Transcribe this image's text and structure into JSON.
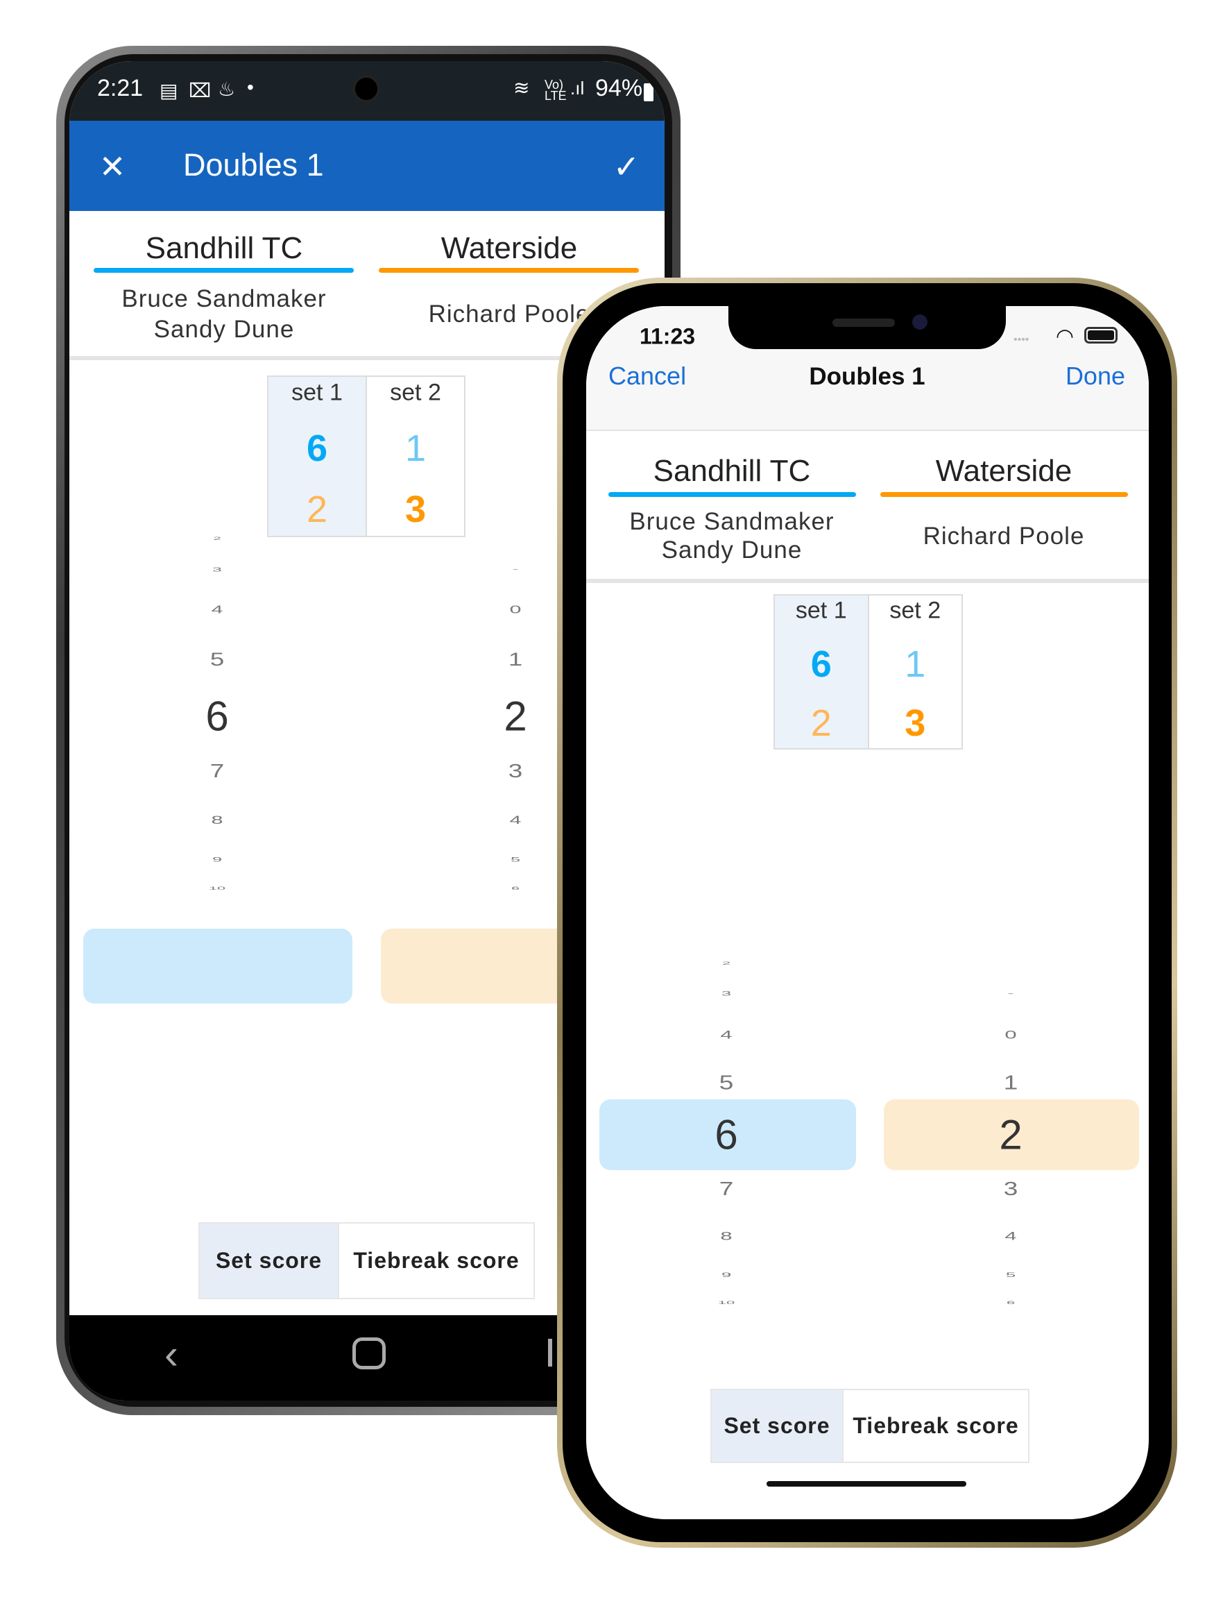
{
  "colors": {
    "home": "#03a9f4",
    "away": "#ff9800",
    "android_appbar": "#1565c0",
    "ios_link": "#1a6fd6",
    "home_highlight": "#cdeafc",
    "away_highlight": "#fdebd0",
    "set_selected_bg": "#ecf2fa"
  },
  "android": {
    "status": {
      "time": "2:21",
      "battery": "94%",
      "icons": [
        "calendar-icon",
        "outlook-icon",
        "notification-icon",
        "dot-icon",
        "wifi-icon",
        "volte-icon",
        "signal-icon",
        "battery-icon"
      ]
    },
    "appbar": {
      "title": "Doubles 1",
      "close_icon": "close-icon",
      "confirm_icon": "check-icon"
    },
    "nav_icons": [
      "back-icon",
      "home-icon",
      "recents-icon"
    ]
  },
  "ios": {
    "status": {
      "time": "11:23"
    },
    "navbar": {
      "cancel": "Cancel",
      "title": "Doubles 1",
      "done": "Done"
    }
  },
  "match": {
    "home": {
      "team": "Sandhill TC",
      "players": [
        "Bruce Sandmaker",
        "Sandy Dune"
      ]
    },
    "away": {
      "team": "Waterside",
      "players": [
        "Richard Poole"
      ]
    },
    "sets": [
      {
        "label": "set 1",
        "home": "6",
        "away": "2",
        "selected": true
      },
      {
        "label": "set 2",
        "home": "1",
        "away": "3",
        "selected": false
      }
    ]
  },
  "picker": {
    "home": {
      "items": [
        "2",
        "3",
        "4",
        "5",
        "6",
        "7",
        "8",
        "9",
        "10"
      ],
      "selected": "6"
    },
    "away": {
      "items": [
        "-",
        "0",
        "1",
        "2",
        "3",
        "4",
        "5",
        "6"
      ],
      "selected": "2"
    }
  },
  "segments": {
    "set": "Set score",
    "tiebreak": "Tiebreak score",
    "active": "Set score"
  }
}
